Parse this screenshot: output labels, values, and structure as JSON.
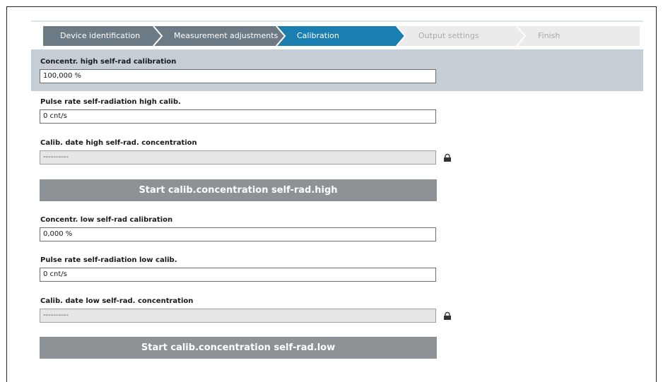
{
  "wizard": {
    "steps": [
      {
        "label": "Device identification",
        "state": "done"
      },
      {
        "label": "Measurement adjustments",
        "state": "done"
      },
      {
        "label": "Calibration",
        "state": "active"
      },
      {
        "label": "Output settings",
        "state": "pending"
      },
      {
        "label": "Finish",
        "state": "pending"
      }
    ]
  },
  "colors": {
    "done": "#6c7a85",
    "active": "#1a7fb0",
    "pending": "#ebebeb",
    "highlight": "#c5ced5",
    "button": "#8c9296"
  },
  "form": {
    "high_conc": {
      "label": "Concentr. high self-rad calibration",
      "value": "100,000 %"
    },
    "high_pulse": {
      "label": "Pulse rate self-radiation high calib.",
      "value": "0 cnt/s"
    },
    "high_date": {
      "label": "Calib. date high self-rad. concentration",
      "value": "----------"
    },
    "high_button": "Start calib.concentration self-rad.high",
    "low_conc": {
      "label": "Concentr. low self-rad calibration",
      "value": "0,000 %"
    },
    "low_pulse": {
      "label": "Pulse rate self-radiation low calib.",
      "value": "0 cnt/s"
    },
    "low_date": {
      "label": "Calib. date low self-rad. concentration",
      "value": "----------"
    },
    "low_button": "Start calib.concentration self-rad.low"
  }
}
